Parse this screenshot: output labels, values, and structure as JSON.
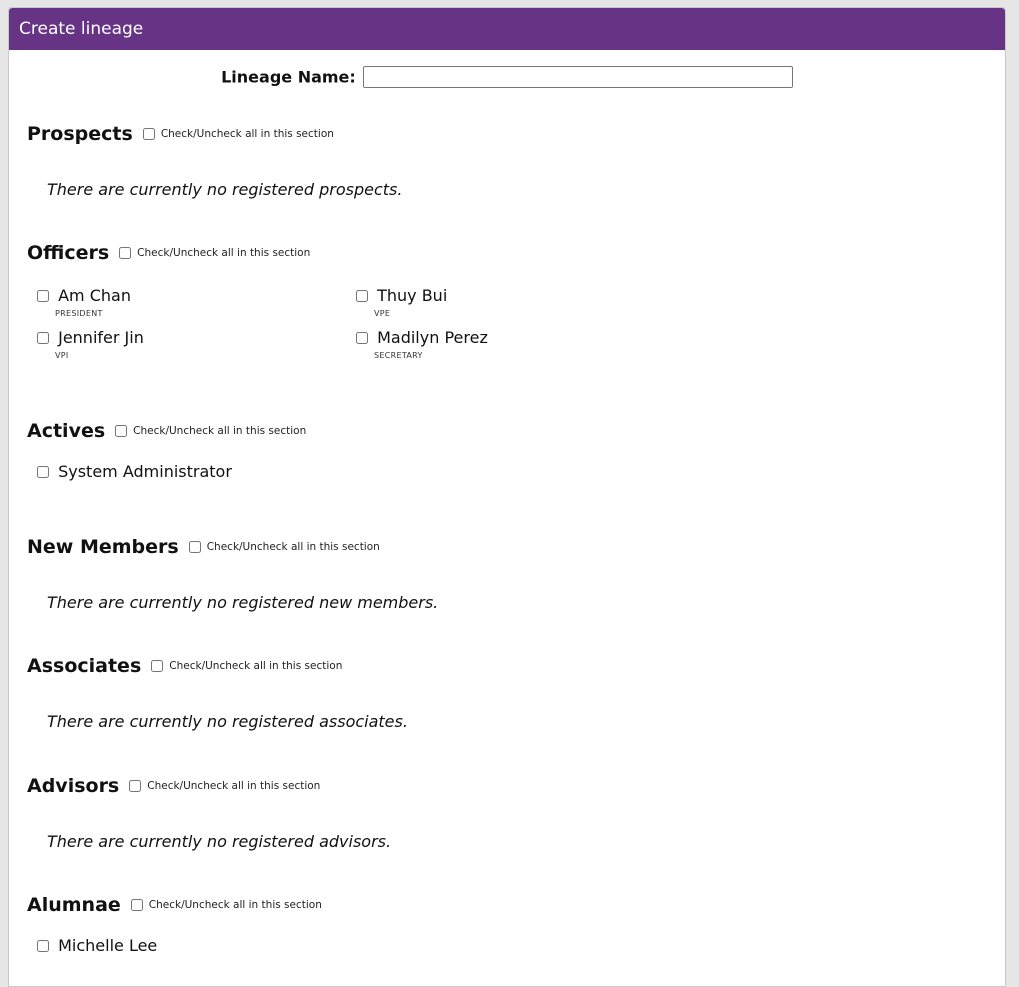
{
  "header": {
    "title": "Create lineage"
  },
  "form": {
    "name_label": "Lineage Name:",
    "name_value": ""
  },
  "check_all_label": "Check/Uncheck all in this section",
  "sections": {
    "prospects": {
      "title": "Prospects",
      "empty_text": "There are currently no registered prospects."
    },
    "officers": {
      "title": "Officers",
      "members": [
        {
          "name": "Am Chan",
          "role": "PRESIDENT"
        },
        {
          "name": "Thuy Bui",
          "role": "VPE"
        },
        {
          "name": "Jennifer Jin",
          "role": "VPI"
        },
        {
          "name": "Madilyn Perez",
          "role": "SECRETARY"
        }
      ]
    },
    "actives": {
      "title": "Actives",
      "members": [
        {
          "name": "System Administrator"
        }
      ]
    },
    "new_members": {
      "title": "New Members",
      "empty_text": "There are currently no registered new members."
    },
    "associates": {
      "title": "Associates",
      "empty_text": "There are currently no registered associates."
    },
    "advisors": {
      "title": "Advisors",
      "empty_text": "There are currently no registered advisors."
    },
    "alumnae": {
      "title": "Alumnae",
      "members": [
        {
          "name": "Michelle Lee"
        }
      ]
    }
  }
}
